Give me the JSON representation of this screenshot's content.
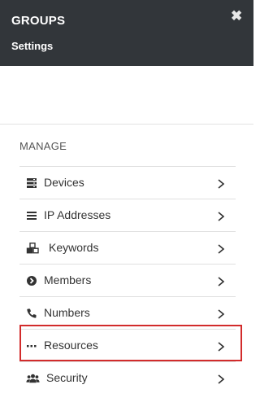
{
  "header": {
    "title": "GROUPS",
    "subtitle": "Settings",
    "close_icon": "close-icon"
  },
  "section": {
    "label": "MANAGE"
  },
  "items": [
    {
      "label": "Devices",
      "icon": "server-icon"
    },
    {
      "label": "IP Addresses",
      "icon": "list-icon"
    },
    {
      "label": "Keywords",
      "icon": "cubes-icon"
    },
    {
      "label": "Members",
      "icon": "arrow-circle-icon"
    },
    {
      "label": "Numbers",
      "icon": "phone-icon"
    },
    {
      "label": "Resources",
      "icon": "ellipsis-icon"
    },
    {
      "label": "Security",
      "icon": "users-icon"
    }
  ],
  "colors": {
    "header_bg": "#32363a",
    "highlight": "#d22b2b"
  }
}
